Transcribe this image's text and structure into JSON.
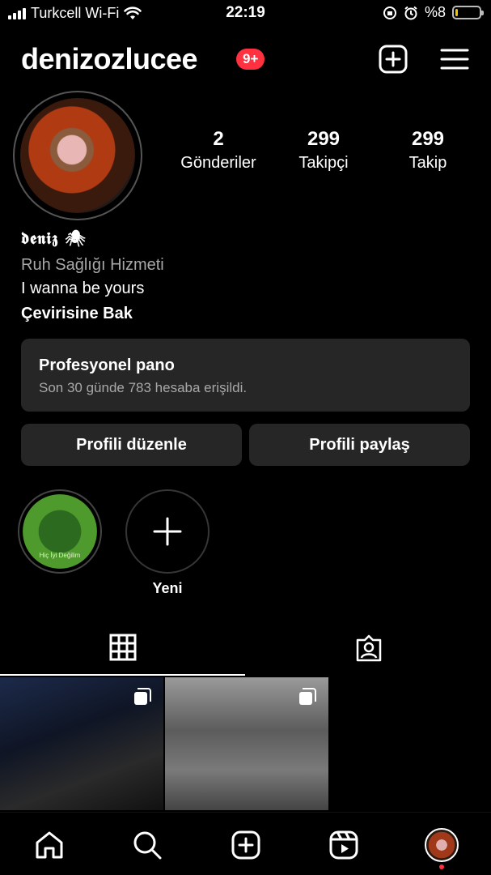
{
  "status_bar": {
    "carrier": "Turkcell Wi-Fi",
    "time": "22:19",
    "battery_text": "%8",
    "battery_color": "#f5c500"
  },
  "header": {
    "username": "denizozlucee",
    "notification_badge": "9+",
    "icons": [
      "add-content-icon",
      "menu-icon"
    ]
  },
  "profile": {
    "stats": [
      {
        "value": "2",
        "label": "Gönderiler"
      },
      {
        "value": "299",
        "label": "Takipçi"
      },
      {
        "value": "299",
        "label": "Takip"
      }
    ],
    "bio": {
      "name": "𝖉𝖊𝖓𝖎𝖟 🕷",
      "category": "Ruh Sağlığı Hizmeti",
      "text": "I wanna be yours",
      "translate": "Çevirisine Bak"
    }
  },
  "pro_panel": {
    "title": "Profesyonel pano",
    "subtitle": "Son 30 günde 783 hesaba erişildi."
  },
  "buttons": {
    "edit": "Profili düzenle",
    "share": "Profili paylaş"
  },
  "highlights": [
    {
      "label": "",
      "inner_text": "Hiç İyi Değilim"
    },
    {
      "label": "Yeni"
    }
  ],
  "tabs": [
    "grid-icon",
    "tagged-icon"
  ],
  "posts": [
    {
      "type": "carousel"
    },
    {
      "type": "carousel"
    }
  ],
  "bottom_nav": [
    "home-icon",
    "search-icon",
    "create-icon",
    "reels-icon",
    "profile-avatar"
  ],
  "colors": {
    "background": "#000000",
    "surface": "#262626",
    "badge": "#ff3040",
    "secondary_text": "#a8a8a8"
  }
}
